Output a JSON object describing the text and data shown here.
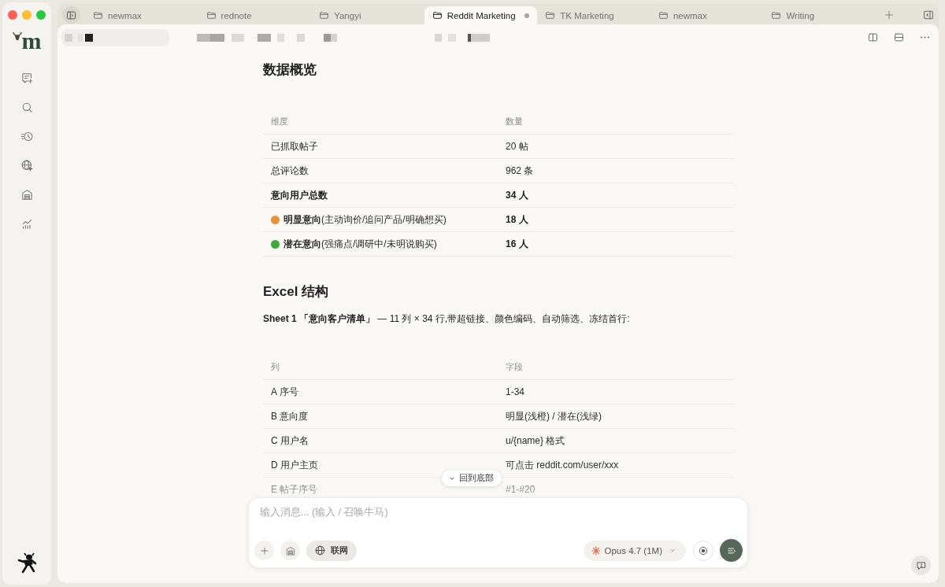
{
  "sidebar": {
    "logo": "m"
  },
  "tabs": [
    {
      "label": "newmax",
      "selected": false,
      "modified": false
    },
    {
      "label": "rednote",
      "selected": false,
      "modified": false
    },
    {
      "label": "Yangyi",
      "selected": false,
      "modified": false
    },
    {
      "label": "Reddit Marketing",
      "selected": true,
      "modified": true
    },
    {
      "label": "TK Marketing",
      "selected": false,
      "modified": false
    },
    {
      "label": "newmax",
      "selected": false,
      "modified": false
    },
    {
      "label": "Writing",
      "selected": false,
      "modified": false
    }
  ],
  "document": {
    "sections": [
      {
        "heading": "数据概览",
        "table": {
          "columns": [
            "维度",
            "数量"
          ],
          "rows": [
            {
              "cells": [
                {
                  "text": "已抓取帖子",
                  "bold": false
                },
                {
                  "text": "20 帖",
                  "bold": false
                }
              ]
            },
            {
              "cells": [
                {
                  "text": "总评论数",
                  "bold": false
                },
                {
                  "text": "962 条",
                  "bold": false
                }
              ]
            },
            {
              "cells": [
                {
                  "text": "意向用户总数",
                  "bold": true
                },
                {
                  "text": "34 人",
                  "bold": true
                }
              ]
            },
            {
              "color": "#e8923a",
              "cells": [
                {
                  "text": "**明显意向**(主动询价/追问产品/明确想买)",
                  "bold": false
                },
                {
                  "text": "18 人",
                  "bold": true
                }
              ]
            },
            {
              "color": "#3daa3d",
              "cells": [
                {
                  "text": "**潜在意向**(强痛点/调研中/未明说购买)",
                  "bold": false
                },
                {
                  "text": "16 人",
                  "bold": true
                }
              ]
            }
          ]
        }
      },
      {
        "heading": "Excel 结构",
        "paragraph": "**Sheet 1 「意向客户清单」** — 11 列 × 34 行,带超链接、颜色编码、自动筛选、冻结首行:",
        "table": {
          "columns": [
            "列",
            "字段"
          ],
          "rows": [
            {
              "cells": [
                {
                  "text": "A 序号",
                  "bold": false
                },
                {
                  "text": "1-34",
                  "bold": false
                }
              ]
            },
            {
              "cells": [
                {
                  "text": "B 意向度",
                  "bold": false
                },
                {
                  "text": "明显(浅橙) / 潜在(浅绿)",
                  "bold": false
                }
              ]
            },
            {
              "cells": [
                {
                  "text": "C 用户名",
                  "bold": false
                },
                {
                  "text": "u/{name} 格式",
                  "bold": false
                }
              ]
            },
            {
              "cells": [
                {
                  "text": "D 用户主页",
                  "bold": false
                },
                {
                  "text": "可点击 reddit.com/user/xxx",
                  "bold": false
                }
              ]
            },
            {
              "cells": [
                {
                  "text": "E 帖子序号",
                  "bold": false
                },
                {
                  "text": "#1-#20",
                  "bold": false
                }
              ]
            }
          ]
        }
      }
    ]
  },
  "scroll_button": {
    "label": "回到底部"
  },
  "composer": {
    "placeholder": "输入消息... (输入 / 召唤牛马)",
    "web_toggle": {
      "label": "联网",
      "on": true
    },
    "model": {
      "label": "Opus 4.7 (1M)"
    }
  }
}
